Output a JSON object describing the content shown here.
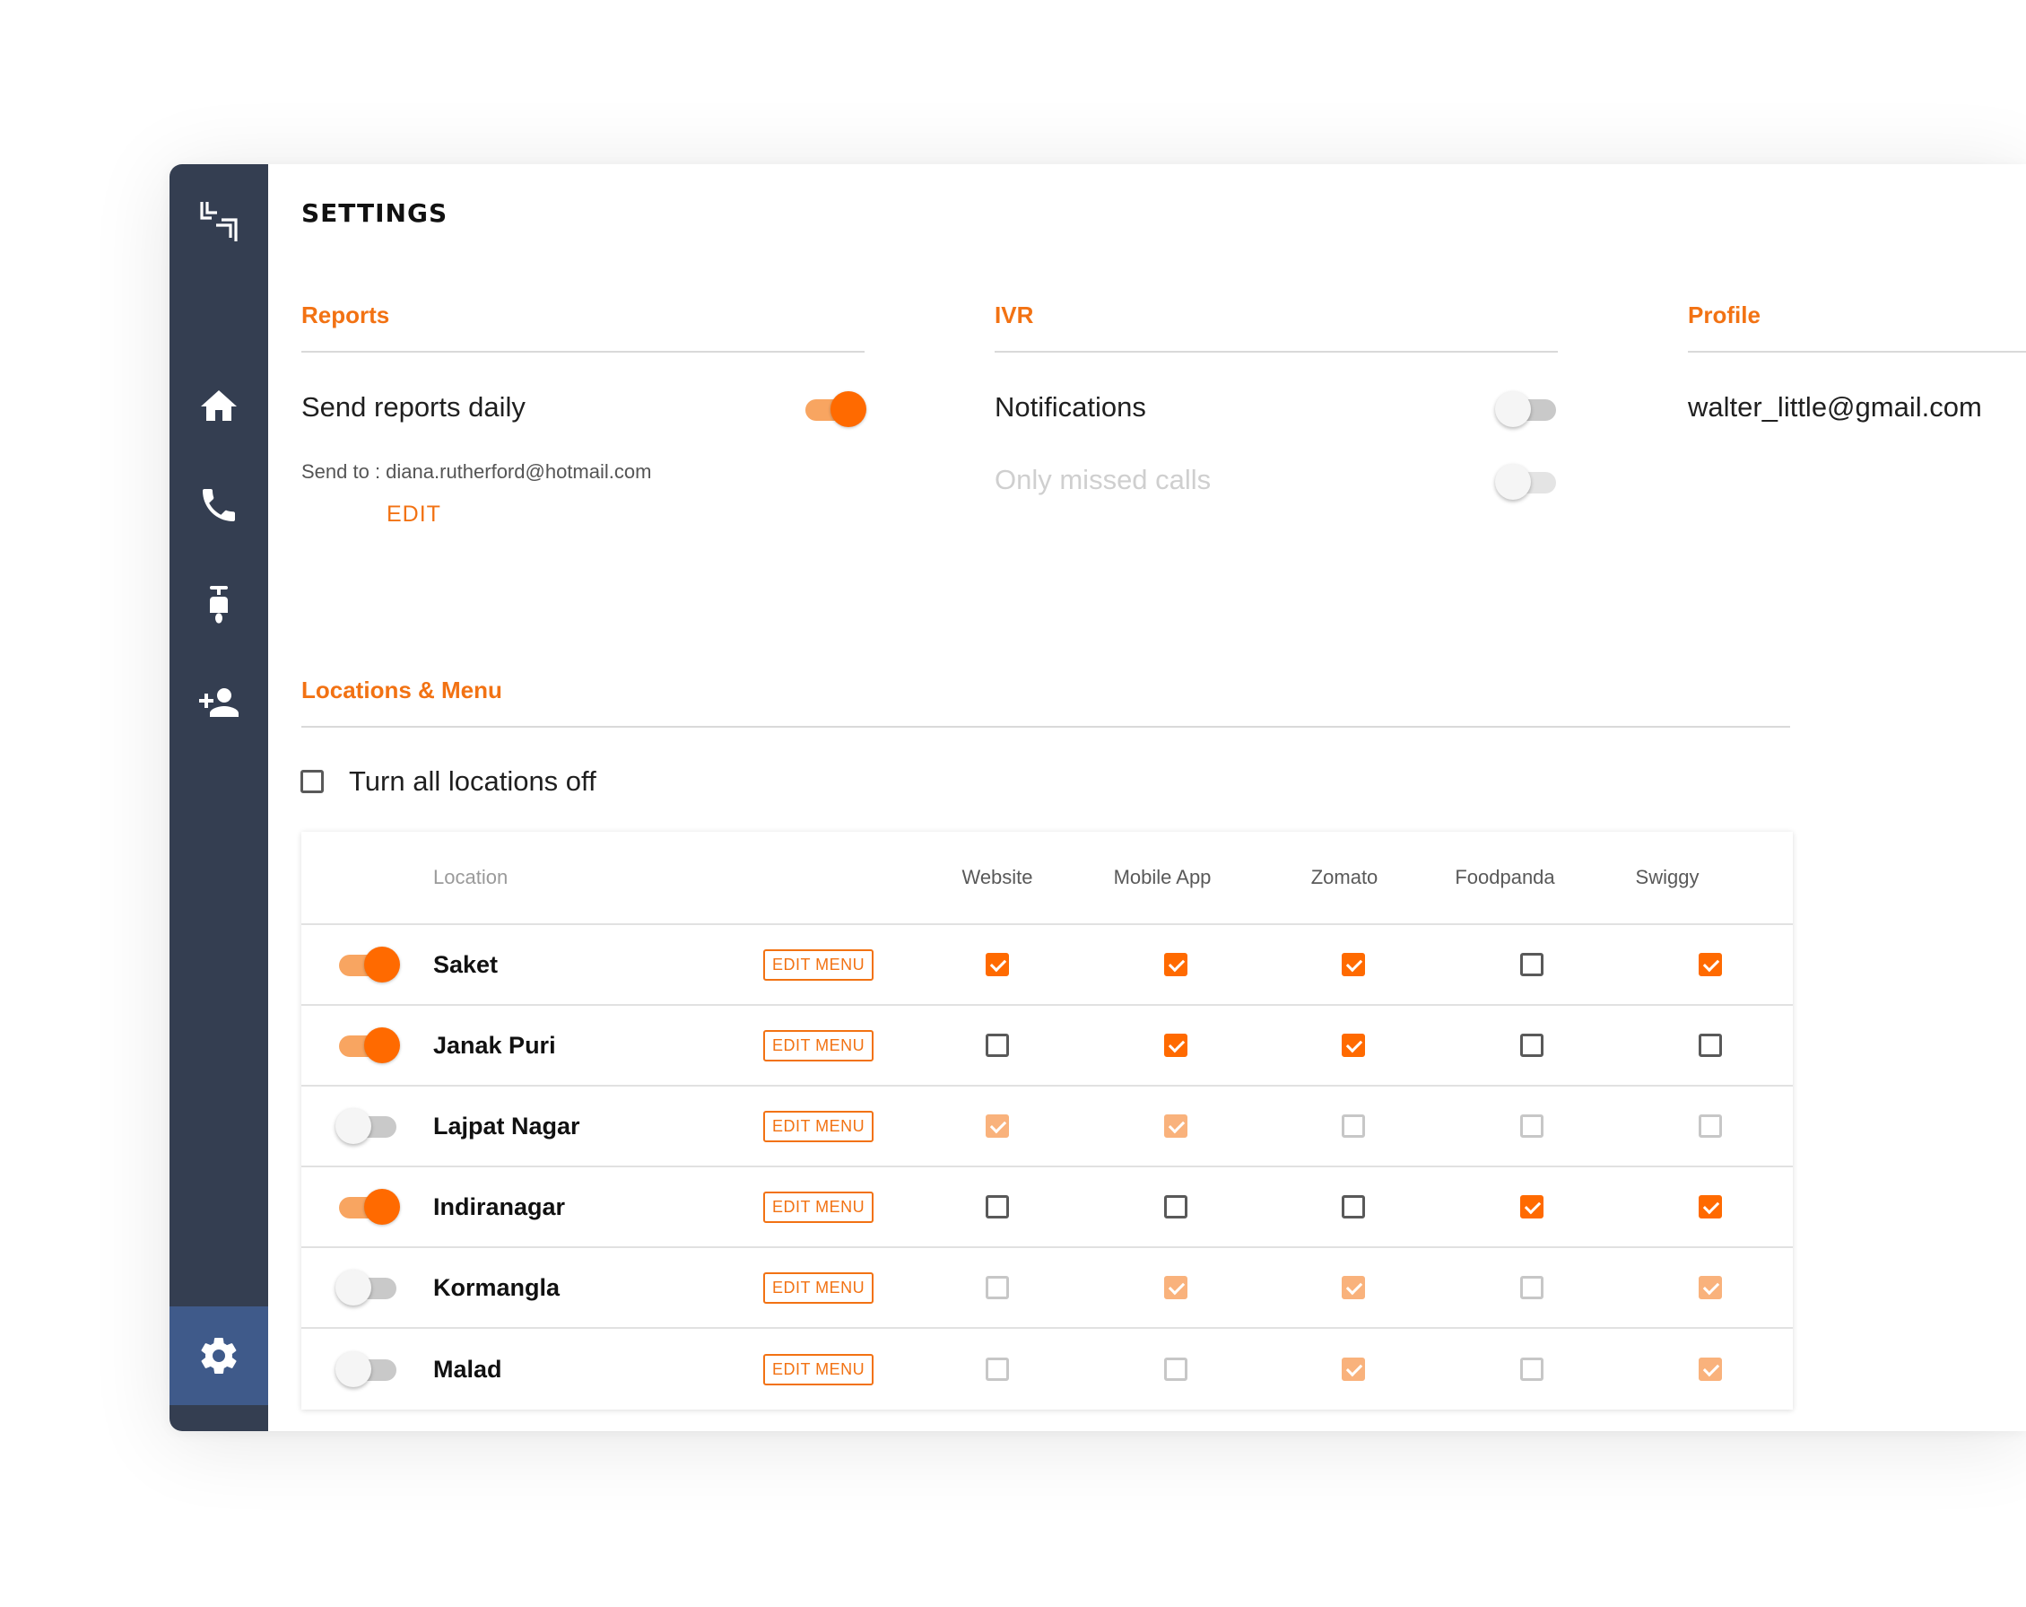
{
  "page_title": "SETTINGS",
  "sections": {
    "reports": {
      "title": "Reports",
      "send_daily_label": "Send reports daily",
      "send_daily_on": true,
      "send_to_text": "Send to : diana.rutherford@hotmail.com",
      "edit_label": "EDIT"
    },
    "ivr": {
      "title": "IVR",
      "notifications_label": "Notifications",
      "notifications_on": false,
      "missed_calls_label": "Only missed calls",
      "missed_calls_on": false
    },
    "profile": {
      "title": "Profile",
      "email": "walter_little@gmail.com"
    },
    "locations": {
      "title": "Locations & Menu",
      "turn_all_off_label": "Turn all locations off",
      "turn_all_off_checked": false
    }
  },
  "sidebar": {
    "items": [
      {
        "icon": "home-icon"
      },
      {
        "icon": "phone-icon"
      },
      {
        "icon": "scooter-icon"
      },
      {
        "icon": "add-user-icon"
      },
      {
        "icon": "gear-icon",
        "active": true
      }
    ]
  },
  "table": {
    "headers": [
      "Location",
      "Website",
      "Mobile App",
      "Zomato",
      "Foodpanda",
      "Swiggy"
    ],
    "edit_menu_label": "EDIT MENU",
    "rows": [
      {
        "name": "Saket",
        "enabled": true,
        "channels": [
          true,
          true,
          true,
          false,
          true
        ]
      },
      {
        "name": "Janak Puri",
        "enabled": true,
        "channels": [
          false,
          true,
          true,
          false,
          false
        ]
      },
      {
        "name": "Lajpat Nagar",
        "enabled": false,
        "channels": [
          true,
          true,
          false,
          false,
          false
        ]
      },
      {
        "name": "Indiranagar",
        "enabled": true,
        "channels": [
          false,
          false,
          false,
          true,
          true
        ]
      },
      {
        "name": "Kormangla",
        "enabled": false,
        "channels": [
          false,
          true,
          true,
          false,
          true
        ]
      },
      {
        "name": "Malad",
        "enabled": false,
        "channels": [
          false,
          false,
          true,
          false,
          true
        ]
      }
    ]
  },
  "colors": {
    "accent": "#ff6a00",
    "accent_text": "#f27213",
    "sidebar_bg": "#343e51",
    "sidebar_active": "#3f5a8a"
  }
}
